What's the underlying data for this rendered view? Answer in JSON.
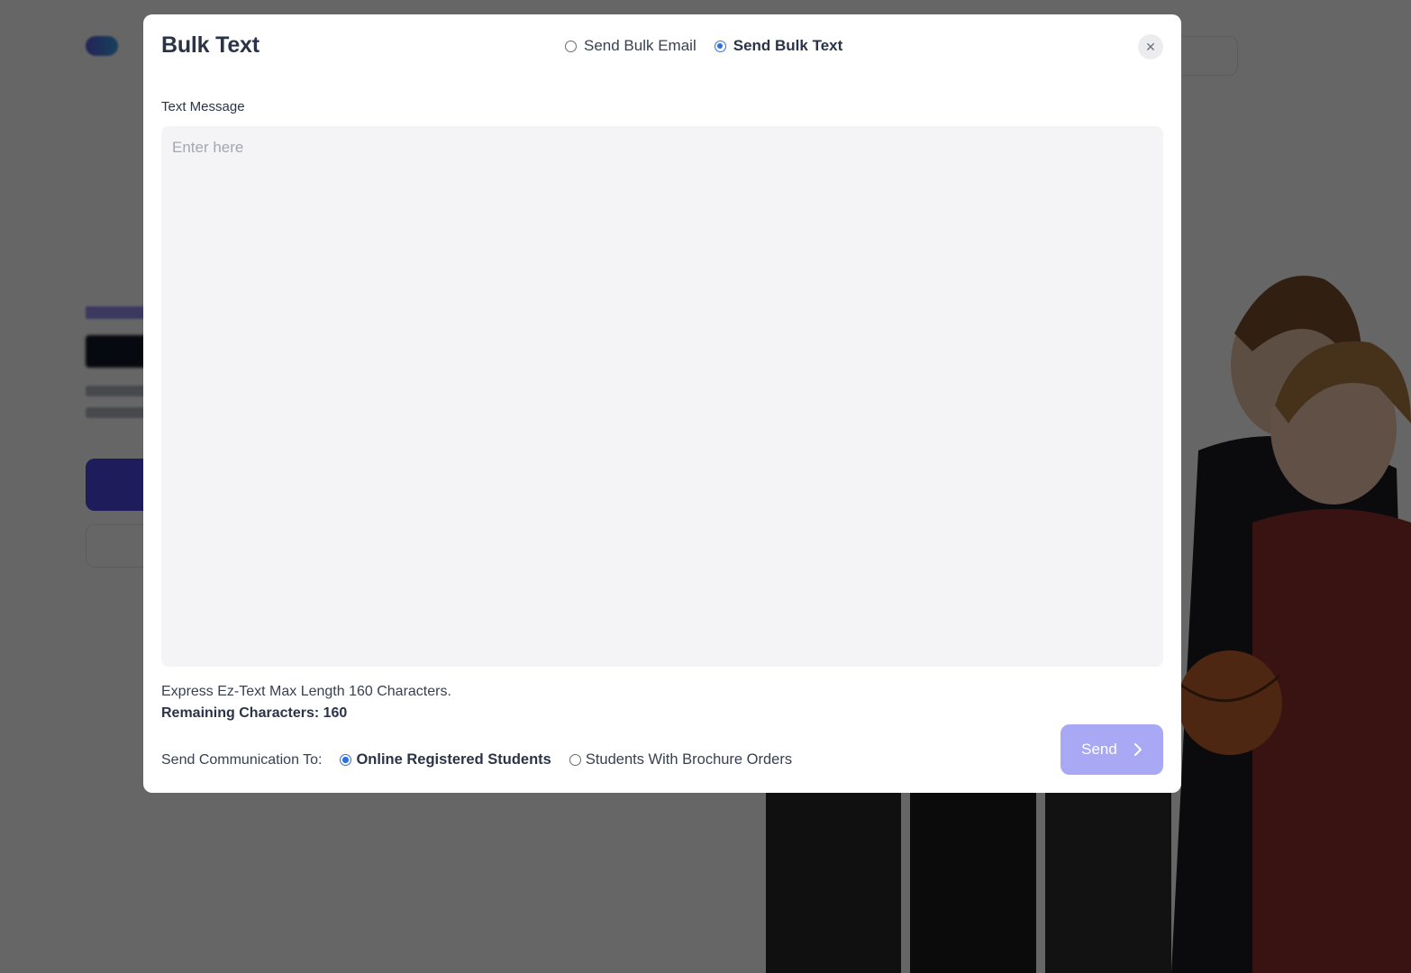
{
  "modal": {
    "title": "Bulk Text",
    "type_options": [
      {
        "label": "Send Bulk Email",
        "checked": false
      },
      {
        "label": "Send Bulk Text",
        "checked": true
      }
    ],
    "close_icon": "close-icon"
  },
  "message": {
    "label": "Text Message",
    "placeholder": "Enter here",
    "value": ""
  },
  "limits": {
    "hint": "Express Ez-Text Max Length 160 Characters.",
    "remaining": "Remaining Characters: 160"
  },
  "recipients": {
    "label": "Send Communication To:",
    "options": [
      {
        "label": "Online Registered Students",
        "checked": true
      },
      {
        "label": "Students With Brochure Orders",
        "checked": false
      }
    ]
  },
  "actions": {
    "send_label": "Send",
    "send_icon": "chevron-right-icon"
  },
  "colors": {
    "accent": "#2f6fe0",
    "send_button": "#a8a8f5",
    "overlay": "rgba(0,0,0,0.6)"
  }
}
